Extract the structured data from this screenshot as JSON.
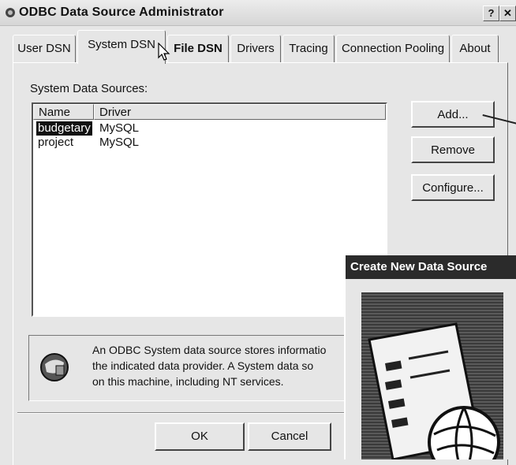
{
  "window": {
    "title": "ODBC Data Source Administrator",
    "help_glyph": "?",
    "close_glyph": "✕"
  },
  "tabs": [
    {
      "label": "User DSN"
    },
    {
      "label": "System DSN"
    },
    {
      "label": "File DSN"
    },
    {
      "label": "Drivers"
    },
    {
      "label": "Tracing"
    },
    {
      "label": "Connection Pooling"
    },
    {
      "label": "About"
    }
  ],
  "active_tab": "System DSN",
  "section_label": "System Data Sources:",
  "list": {
    "columns": [
      "Name",
      "Driver"
    ],
    "rows": [
      {
        "name": "budgetary",
        "driver": "MySQL",
        "selected": true
      },
      {
        "name": "project",
        "driver": "MySQL",
        "selected": false
      }
    ]
  },
  "buttons": {
    "add": "Add...",
    "remove": "Remove",
    "configure": "Configure...",
    "ok": "OK",
    "cancel": "Cancel"
  },
  "info": {
    "text": "An ODBC System data source stores informatio\nthe indicated data provider.  A System data so\non this machine, including NT services."
  },
  "popup": {
    "title": "Create New Data Source"
  }
}
